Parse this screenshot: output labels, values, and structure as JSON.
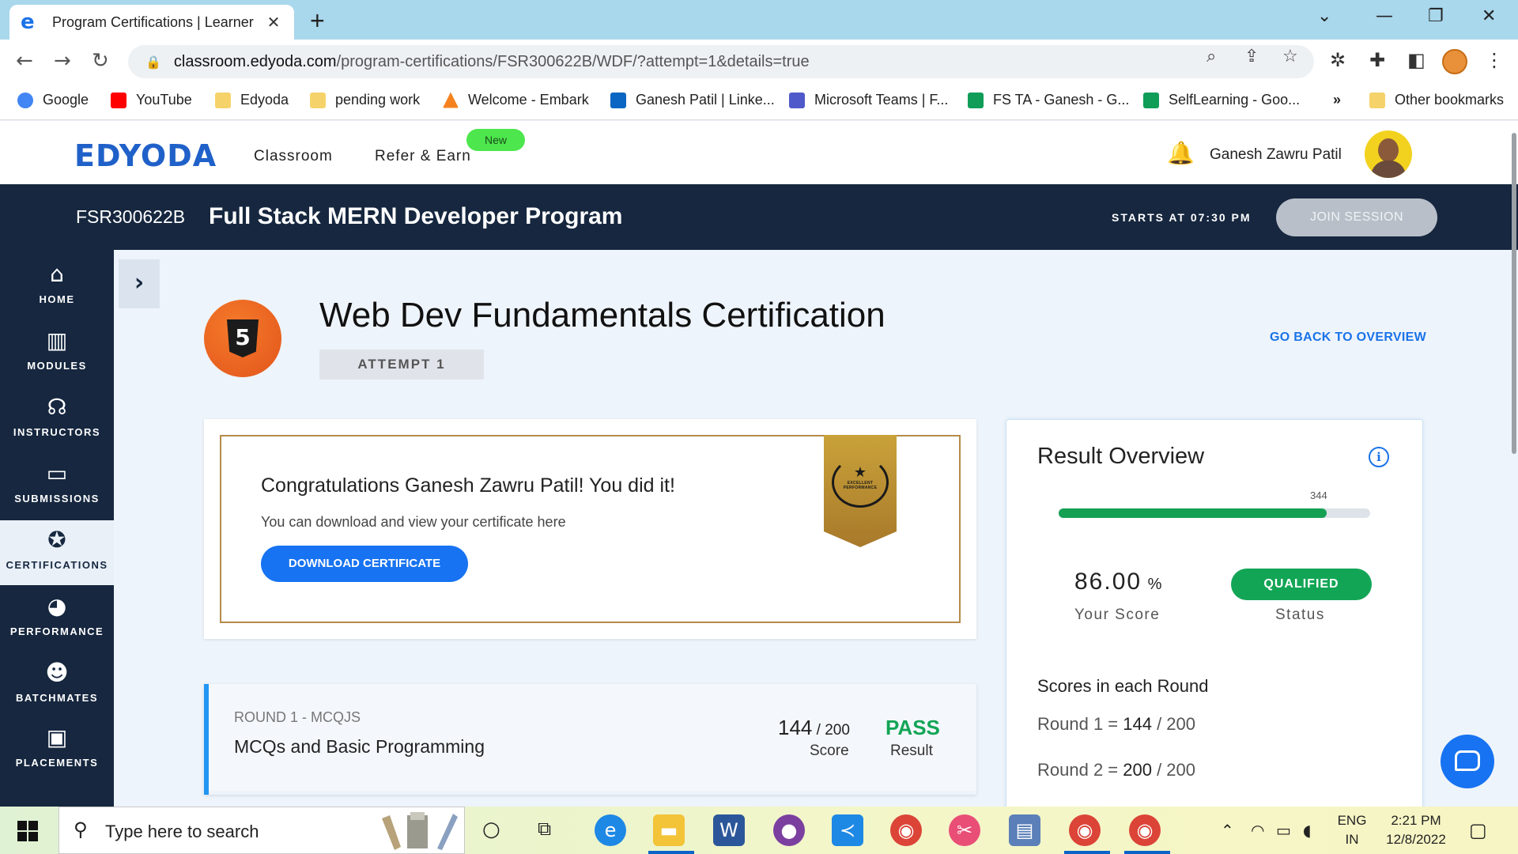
{
  "browser": {
    "tab_title": "Program Certifications | Learner",
    "tab_close": "✕",
    "new_tab": "+",
    "url_host": "classroom.edyoda.com",
    "url_path": "/program-certifications/FSR300622B/WDF/?attempt=1&details=true",
    "bookmarks": [
      {
        "label": "Google",
        "color": "#4285f4"
      },
      {
        "label": "YouTube",
        "color": "#ff0000"
      },
      {
        "label": "Edyoda",
        "color": "#f6d36a"
      },
      {
        "label": "pending work",
        "color": "#f6d36a"
      },
      {
        "label": "Welcome - Embark",
        "color": "#f5821f"
      },
      {
        "label": "Ganesh Patil | Linke...",
        "color": "#0a66c2"
      },
      {
        "label": "Microsoft Teams | F...",
        "color": "#5059c9"
      },
      {
        "label": "FS TA - Ganesh - G...",
        "color": "#0f9d58"
      },
      {
        "label": "SelfLearning - Goo...",
        "color": "#0f9d58"
      }
    ],
    "bookmarks_overflow": "»",
    "other_bookmarks": "Other bookmarks"
  },
  "site": {
    "logo": "EDYODA",
    "nav": [
      {
        "label": "Classroom"
      },
      {
        "label": "Refer & Earn"
      }
    ],
    "new_badge": "New",
    "user_name": "Ganesh Zawru Patil"
  },
  "program": {
    "code": "FSR300622B",
    "name": "Full Stack MERN Developer Program",
    "starts_at": "STARTS AT 07:30 PM",
    "join_label": "JOIN SESSION"
  },
  "sidebar": {
    "items": [
      {
        "label": "HOME",
        "icon": "home-icon",
        "glyph": "⌂"
      },
      {
        "label": "MODULES",
        "icon": "modules-icon",
        "glyph": "▥"
      },
      {
        "label": "INSTRUCTORS",
        "icon": "instructors-icon",
        "glyph": "☊"
      },
      {
        "label": "SUBMISSIONS",
        "icon": "submissions-icon",
        "glyph": "▭"
      },
      {
        "label": "CERTIFICATIONS",
        "icon": "certifications-icon",
        "glyph": "✪"
      },
      {
        "label": "PERFORMANCE",
        "icon": "performance-icon",
        "glyph": "◕"
      },
      {
        "label": "BATCHMATES",
        "icon": "batchmates-icon",
        "glyph": "☻"
      },
      {
        "label": "PLACEMENTS",
        "icon": "placements-icon",
        "glyph": "▣"
      }
    ],
    "active_index": 4
  },
  "certification": {
    "badge_text": "5",
    "title": "Web Dev Fundamentals Certification",
    "attempt": "ATTEMPT 1",
    "back_link": "GO BACK TO OVERVIEW",
    "congrats_heading": "Congratulations Ganesh Zawru Patil! You did it!",
    "congrats_sub": "You can download and view your certificate here",
    "download_label": "DOWNLOAD CERTIFICATE",
    "ribbon_text": "EXCELLENT PERFORMANCE"
  },
  "round1": {
    "label": "ROUND 1 - MCQJS",
    "name": "MCQs and Basic Programming",
    "score": "144",
    "score_total": " / 200",
    "score_label": "Score",
    "result": "PASS",
    "result_label": "Result"
  },
  "result_overview": {
    "title": "Result Overview",
    "info": "i",
    "progress_value": "344",
    "progress_fraction": 0.86,
    "score": "86.00",
    "score_unit": " %",
    "score_label": "Your Score",
    "status": "QUALIFIED",
    "status_label": "Status",
    "rounds_title": "Scores in each Round",
    "rounds": [
      {
        "prefix": "Round 1 = ",
        "score": "144",
        "total": " / 200"
      },
      {
        "prefix": "Round 2 = ",
        "score": "200",
        "total": " / 200"
      }
    ]
  },
  "taskbar": {
    "search_placeholder": "Type here to search",
    "lang_1": "ENG",
    "lang_2": "IN",
    "time": "2:21 PM",
    "date": "12/8/2022"
  },
  "colors": {
    "brand": "#2061c9",
    "nav_dark": "#16273f",
    "accent": "#1773f1",
    "success": "#12a556"
  }
}
